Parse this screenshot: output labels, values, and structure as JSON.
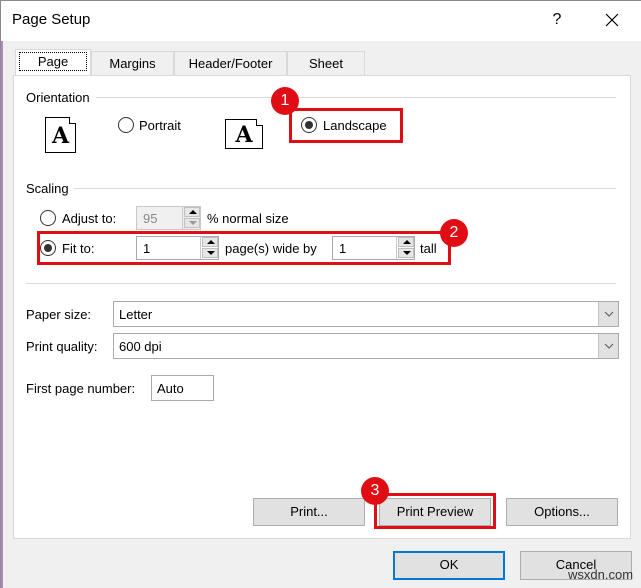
{
  "window": {
    "title": "Page Setup",
    "help_label": "?",
    "close_icon": "close-icon"
  },
  "tabs": [
    {
      "label": "Page",
      "active": true
    },
    {
      "label": "Margins",
      "active": false
    },
    {
      "label": "Header/Footer",
      "active": false
    },
    {
      "label": "Sheet",
      "active": false
    }
  ],
  "orientation": {
    "group_label": "Orientation",
    "portrait_label": "Portrait",
    "portrait_checked": false,
    "landscape_label": "Landscape",
    "landscape_checked": true,
    "icon_glyph": "A"
  },
  "scaling": {
    "group_label": "Scaling",
    "adjust_label": "Adjust to:",
    "adjust_checked": false,
    "adjust_value": "95",
    "adjust_suffix": "% normal size",
    "fit_label": "Fit to:",
    "fit_checked": true,
    "fit_wide_value": "1",
    "fit_wide_suffix": "page(s) wide by",
    "fit_tall_value": "1",
    "fit_tall_suffix": "tall"
  },
  "paper": {
    "paper_size_label": "Paper size:",
    "paper_size_value": "Letter",
    "print_quality_label": "Print quality:",
    "print_quality_value": "600 dpi",
    "first_page_label": "First page number:",
    "first_page_value": "Auto"
  },
  "buttons": {
    "print": "Print...",
    "print_preview": "Print Preview",
    "options": "Options...",
    "ok": "OK",
    "cancel": "Cancel"
  },
  "annotations": {
    "badge_1": "1",
    "badge_2": "2",
    "badge_3": "3",
    "color": "#e00e14"
  },
  "watermark": "wsxdn.com"
}
